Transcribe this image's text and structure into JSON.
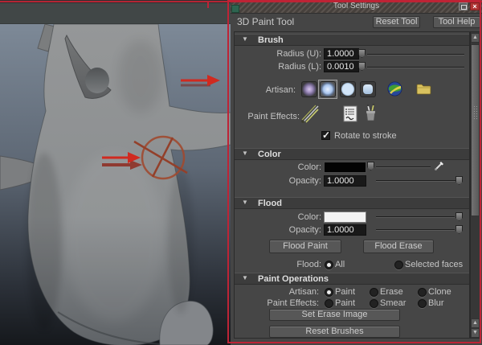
{
  "window": {
    "title": "Tool Settings"
  },
  "icons": {
    "collapse": "▼",
    "check": "✓",
    "scroll_up": "▲",
    "scroll_down": "▼",
    "close": "×",
    "artisan_brushes": [
      "soft-low-falloff-brush-icon",
      "soft-mid-falloff-brush-icon",
      "solid-circle-brush-icon",
      "square-brush-icon"
    ],
    "misc": [
      "sphere-image-icon",
      "folder-icon",
      "paintfx-brush-icon",
      "script-page-icon",
      "brush-holder-icon",
      "eyedropper-icon"
    ]
  },
  "header": {
    "tool_name": "3D Paint Tool",
    "reset_button": "Reset Tool",
    "help_button": "Tool Help"
  },
  "brush": {
    "title": "Brush",
    "radius_u_label": "Radius (U):",
    "radius_u_value": "1.0000",
    "radius_l_label": "Radius (L):",
    "radius_l_value": "0.0010",
    "artisan_label": "Artisan:",
    "paint_effects_label": "Paint Effects:",
    "rotate_label": "Rotate to stroke",
    "rotate_checked": true
  },
  "color": {
    "title": "Color",
    "color_label": "Color:",
    "color_value": "#000000",
    "opacity_label": "Opacity:",
    "opacity_value": "1.0000"
  },
  "flood": {
    "title": "Flood",
    "color_label": "Color:",
    "color_value": "#ffffff",
    "opacity_label": "Opacity:",
    "opacity_value": "1.0000",
    "paint_button": "Flood Paint",
    "erase_button": "Flood Erase",
    "radio_label": "Flood:",
    "options": [
      {
        "label": "All",
        "selected": true
      },
      {
        "label": "Selected faces",
        "selected": false
      }
    ]
  },
  "paint_operations": {
    "title": "Paint Operations",
    "artisan_label": "Artisan:",
    "artisan_options": [
      {
        "label": "Paint",
        "selected": true
      },
      {
        "label": "Erase",
        "selected": false
      },
      {
        "label": "Clone",
        "selected": false
      }
    ],
    "paint_effects_label": "Paint Effects:",
    "paint_effects_options": [
      {
        "label": "Paint",
        "selected": false
      },
      {
        "label": "Smear",
        "selected": false
      },
      {
        "label": "Blur",
        "selected": false
      }
    ],
    "set_erase_button": "Set Erase Image",
    "reset_brushes_button": "Reset Brushes"
  },
  "colors": {
    "annotation_red": "#d02a20",
    "annotation_dark_red": "#8e2418",
    "brush_cursor_red": "#a04a30",
    "border_red": "#bd2436",
    "panel_bg": "#454545",
    "close_button_red": "#b03434"
  }
}
